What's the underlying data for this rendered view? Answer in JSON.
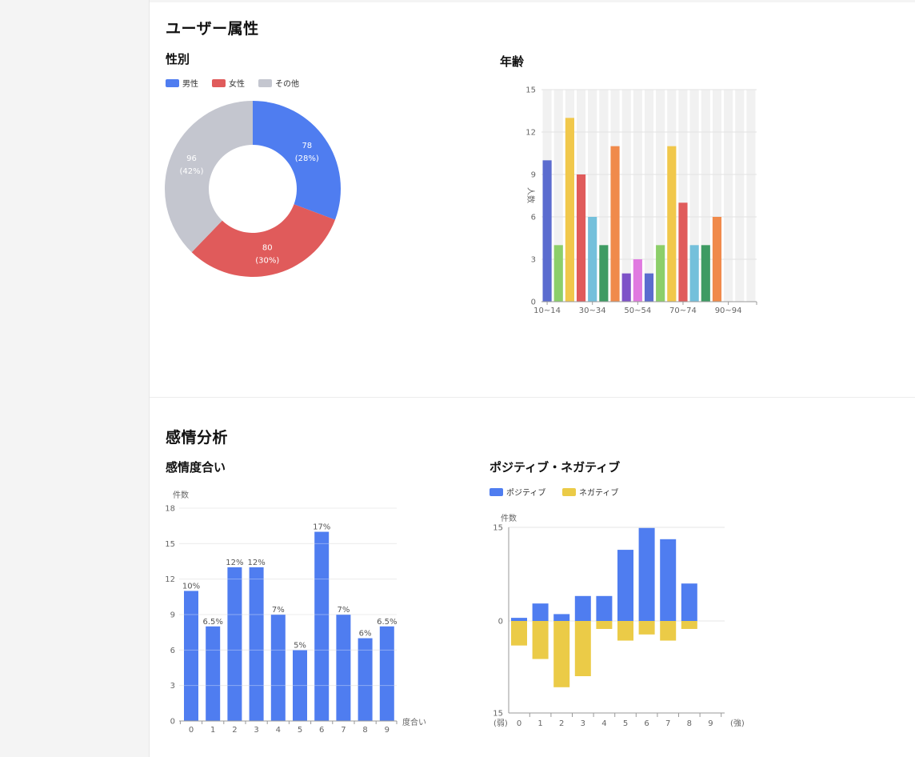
{
  "sections": {
    "attributes": {
      "title": "ユーザー属性",
      "gender_title": "性別",
      "age_title": "年齢"
    },
    "sentiment": {
      "title": "感情分析",
      "degree_title": "感情度合い",
      "posneg_title": "ポジティブ・ネガティブ"
    }
  },
  "colors": {
    "blue": "#4f7df0",
    "red": "#e05b5b",
    "gray": "#c4c6cf",
    "yellow": "#ebcb47"
  },
  "chart_data": [
    {
      "id": "gender",
      "type": "pie",
      "legend": [
        "男性",
        "女性",
        "その他"
      ],
      "values": [
        78,
        80,
        96
      ],
      "labels": [
        "78",
        "80",
        "96"
      ],
      "percent_labels": [
        "(28%)",
        "(30%)",
        "(42%)"
      ],
      "colors": [
        "#4f7df0",
        "#e05b5b",
        "#c4c6cf"
      ],
      "legend_position": "top-left"
    },
    {
      "id": "age",
      "type": "bar",
      "ylabel": "人数",
      "ylim": [
        0,
        15
      ],
      "yticks": [
        "0",
        "3",
        "6",
        "9",
        "12",
        "15"
      ],
      "xtick_labels": [
        "10~14",
        "30~34",
        "50~54",
        "70~74",
        "90~94"
      ],
      "values": [
        10,
        4,
        13,
        9,
        6,
        4,
        11,
        2,
        3,
        2,
        4,
        11,
        7,
        4,
        4,
        6,
        0,
        0,
        0
      ],
      "colors": [
        "#5b6ccf",
        "#8ccf6a",
        "#f1c84b",
        "#e05b5b",
        "#74c0db",
        "#3e9b63",
        "#f08a4b",
        "#7e52c8",
        "#e07ae0",
        "#5b6ccf",
        "#8ccf6a",
        "#f1c84b",
        "#e05b5b",
        "#74c0db",
        "#3e9b63",
        "#f08a4b",
        "#5b6ccf",
        "#8ccf6a",
        "#f1c84b"
      ],
      "grid": true
    },
    {
      "id": "degree",
      "type": "bar",
      "ylabel": "件数",
      "xlabel": "度合い",
      "ylim": [
        0,
        18
      ],
      "yticks": [
        "0",
        "3",
        "6",
        "9",
        "12",
        "15",
        "18"
      ],
      "categories": [
        "0",
        "1",
        "2",
        "3",
        "4",
        "5",
        "6",
        "7",
        "8",
        "9"
      ],
      "values": [
        11,
        8,
        13,
        13,
        9,
        6,
        16,
        9,
        7,
        8
      ],
      "data_labels": [
        "10%",
        "6.5%",
        "12%",
        "12%",
        "7%",
        "5%",
        "17%",
        "7%",
        "6%",
        "6.5%"
      ],
      "color": "#4f7df0",
      "grid": true
    },
    {
      "id": "posneg",
      "type": "bar",
      "ylabel": "件数",
      "ylim": [
        -15,
        15
      ],
      "yticks": [
        "15",
        "0",
        "15"
      ],
      "categories": [
        "0",
        "1",
        "2",
        "3",
        "4",
        "5",
        "6",
        "7",
        "8",
        "9"
      ],
      "left_label": "(弱)",
      "right_label": "(強)",
      "series": [
        {
          "name": "ポジティブ",
          "values": [
            0.5,
            2.8,
            1.1,
            4,
            4,
            11.4,
            14.9,
            13.1,
            6
          ]
        },
        {
          "name": "ネガティブ",
          "values": [
            -4,
            -6.2,
            -10.8,
            -9,
            -1.3,
            -3.2,
            -2.2,
            -3.2,
            -1.3
          ]
        }
      ],
      "colors": [
        "#4f7df0",
        "#ebcb47"
      ],
      "legend_position": "top-left"
    }
  ]
}
